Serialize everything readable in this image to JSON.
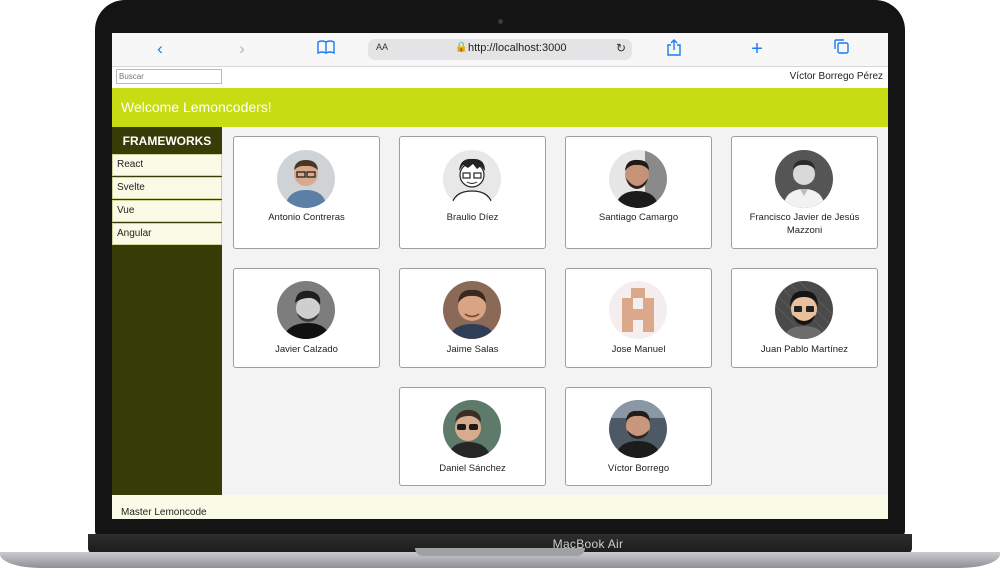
{
  "browser": {
    "url": "http://localhost:3000",
    "text_size_label": "AA"
  },
  "app": {
    "search_placeholder": "Buscar",
    "user_name": "Víctor Borrego Pérez",
    "banner_title": "Welcome Lemoncoders!",
    "footer_text": "Master Lemoncode"
  },
  "sidebar": {
    "title": "FRAMEWORKS",
    "items": [
      {
        "label": "React"
      },
      {
        "label": "Svelte"
      },
      {
        "label": "Vue"
      },
      {
        "label": "Angular"
      }
    ]
  },
  "members": [
    {
      "name": "Antonio Contreras",
      "avatar": "photo-glasses",
      "color": "#5b7fa5"
    },
    {
      "name": "Braulio Díez",
      "avatar": "sketch-glasses",
      "color": "#e8e8e8"
    },
    {
      "name": "Santiago Camargo",
      "avatar": "photo-beard",
      "color": "#6e6e6e"
    },
    {
      "name": "Francisco Javier de Jesús Mazzoni",
      "avatar": "photo-bw",
      "color": "#555555"
    },
    {
      "name": "Javier Calzado",
      "avatar": "photo-bw",
      "color": "#3c3c3c"
    },
    {
      "name": "Jaime Salas",
      "avatar": "photo-color",
      "color": "#8a6a56"
    },
    {
      "name": "Jose Manuel",
      "avatar": "identicon",
      "color": "#dca88b"
    },
    {
      "name": "Juan Pablo Martínez",
      "avatar": "cartoon",
      "color": "#4a4a4a"
    },
    {
      "name": "Daniel Sánchez",
      "avatar": "photo-sunglasses",
      "color": "#5e7a6a"
    },
    {
      "name": "Víctor Borrego",
      "avatar": "photo-color",
      "color": "#4d5a66"
    }
  ],
  "device": {
    "model": "MacBook Air"
  }
}
